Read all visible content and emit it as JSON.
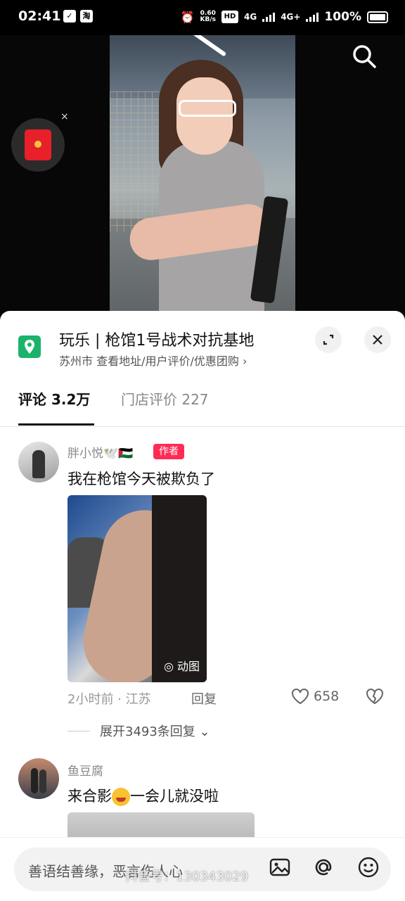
{
  "status_bar": {
    "time": "02:41",
    "netspeed_top": "0.60",
    "netspeed_bottom": "KB/s",
    "hd": "HD",
    "net1": "4G",
    "net2": "4G+",
    "battery": "100%",
    "app_badge": "淘"
  },
  "video": {
    "search_icon": "search-icon",
    "red_packet_icon": "red-packet-icon",
    "close_label": "×"
  },
  "poi": {
    "title": "玩乐 | 枪馆1号战术对抗基地",
    "subtitle": "苏州市  查看地址/用户评价/优惠团购 ›"
  },
  "tabs": [
    {
      "label": "评论 3.2万",
      "active": true
    },
    {
      "label": "门店评价 227",
      "active": false
    }
  ],
  "comments": [
    {
      "username": "胖小悦🕊️🇵🇸",
      "badge": "作者",
      "text": "我在枪馆今天被欺负了",
      "image_badge": "◎ 动图",
      "time": "2小时前 · 江苏",
      "reply": "回复",
      "likes": "658",
      "expand": "展开3493条回复 ⌄"
    },
    {
      "username": "鱼豆腐",
      "text_before": "来合影",
      "text_after": "一会儿就没啦"
    }
  ],
  "input": {
    "placeholder": "善语结善缘，恶言伤人心",
    "watermark": "抖音号：130343029"
  },
  "colors": {
    "accent": "#fe2c55",
    "poi_green": "#1bb36b"
  }
}
